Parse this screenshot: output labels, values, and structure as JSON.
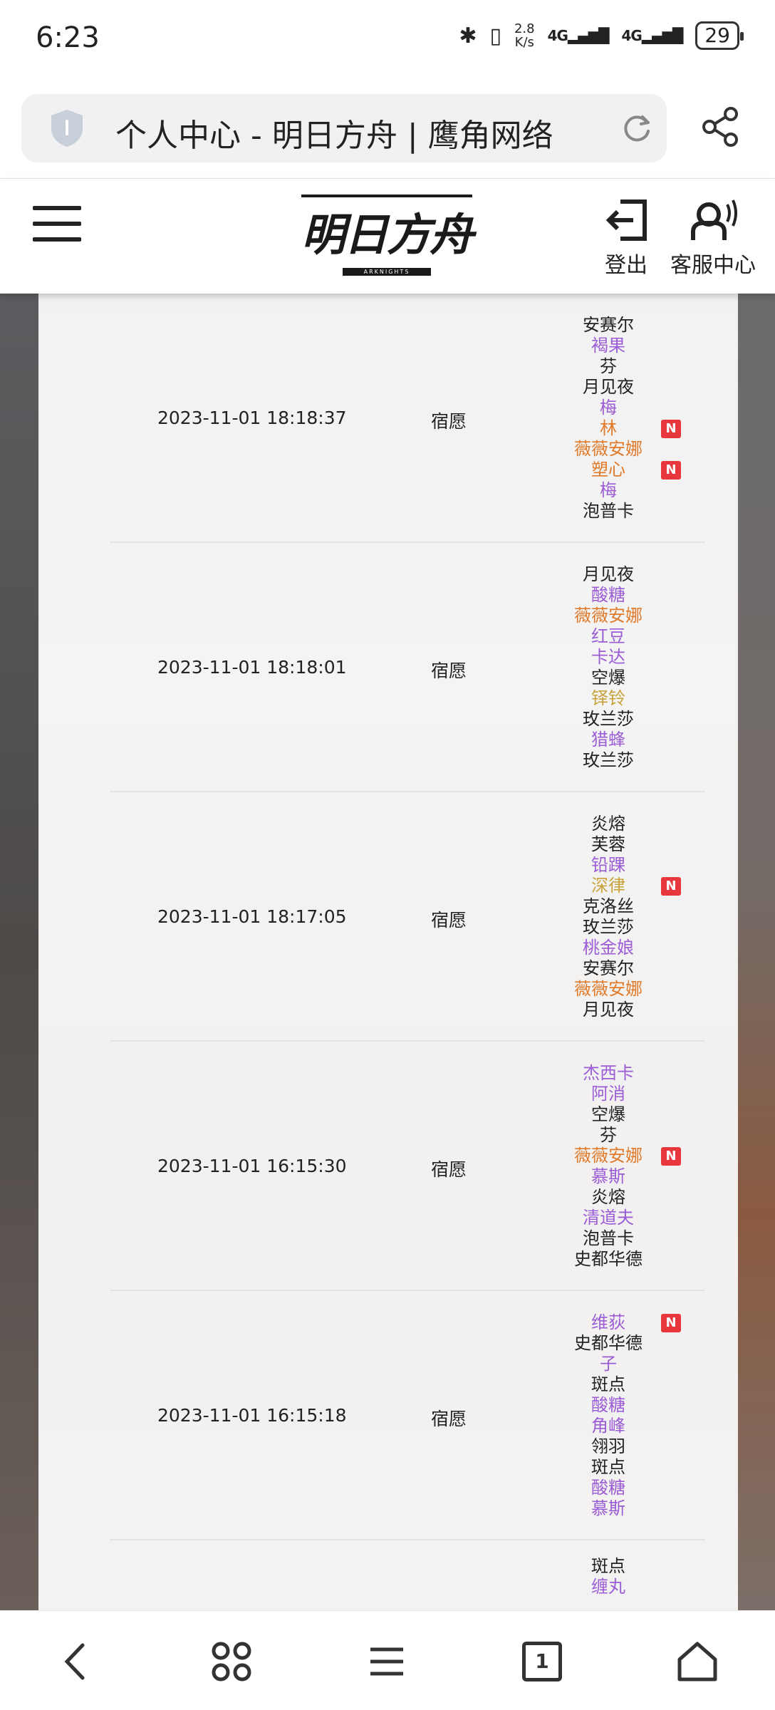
{
  "status_bar": {
    "time": "6:23",
    "net_speed_value": "2.8",
    "net_speed_unit": "K/s",
    "signal_1": "4G",
    "signal_2": "4G",
    "battery": "29"
  },
  "address_bar": {
    "title": "个人中心 - 明日方舟 | 鹰角网络"
  },
  "header": {
    "logo": "明日方舟",
    "logo_subtitle": "ARKNIGHTS",
    "logout_label": "登出",
    "service_label": "客服中心"
  },
  "rarity_colors": {
    "3": "#222222",
    "4": "#9b5cd6",
    "5": "#c8a23a",
    "6": "#e07a2a"
  },
  "records": [
    {
      "date": "2023-11-01 18:18:37",
      "pool": "宿愿",
      "operators": [
        {
          "name": "安赛尔",
          "rarity": 3,
          "new": false
        },
        {
          "name": "褐果",
          "rarity": 4,
          "new": false
        },
        {
          "name": "芬",
          "rarity": 3,
          "new": false
        },
        {
          "name": "月见夜",
          "rarity": 3,
          "new": false
        },
        {
          "name": "梅",
          "rarity": 4,
          "new": false
        },
        {
          "name": "林",
          "rarity": 6,
          "new": true
        },
        {
          "name": "薇薇安娜",
          "rarity": 6,
          "new": false
        },
        {
          "name": "塑心",
          "rarity": 6,
          "new": true
        },
        {
          "name": "梅",
          "rarity": 4,
          "new": false
        },
        {
          "name": "泡普卡",
          "rarity": 3,
          "new": false
        }
      ]
    },
    {
      "date": "2023-11-01 18:18:01",
      "pool": "宿愿",
      "operators": [
        {
          "name": "月见夜",
          "rarity": 3,
          "new": false
        },
        {
          "name": "酸糖",
          "rarity": 4,
          "new": false
        },
        {
          "name": "薇薇安娜",
          "rarity": 6,
          "new": false
        },
        {
          "name": "红豆",
          "rarity": 4,
          "new": false
        },
        {
          "name": "卡达",
          "rarity": 4,
          "new": false
        },
        {
          "name": "空爆",
          "rarity": 3,
          "new": false
        },
        {
          "name": "铎铃",
          "rarity": 5,
          "new": false
        },
        {
          "name": "玫兰莎",
          "rarity": 3,
          "new": false
        },
        {
          "name": "猎蜂",
          "rarity": 4,
          "new": false
        },
        {
          "name": "玫兰莎",
          "rarity": 3,
          "new": false
        }
      ]
    },
    {
      "date": "2023-11-01 18:17:05",
      "pool": "宿愿",
      "operators": [
        {
          "name": "炎熔",
          "rarity": 3,
          "new": false
        },
        {
          "name": "芙蓉",
          "rarity": 3,
          "new": false
        },
        {
          "name": "铅踝",
          "rarity": 4,
          "new": false
        },
        {
          "name": "深律",
          "rarity": 5,
          "new": true
        },
        {
          "name": "克洛丝",
          "rarity": 3,
          "new": false
        },
        {
          "name": "玫兰莎",
          "rarity": 3,
          "new": false
        },
        {
          "name": "桃金娘",
          "rarity": 4,
          "new": false
        },
        {
          "name": "安赛尔",
          "rarity": 3,
          "new": false
        },
        {
          "name": "薇薇安娜",
          "rarity": 6,
          "new": false
        },
        {
          "name": "月见夜",
          "rarity": 3,
          "new": false
        }
      ]
    },
    {
      "date": "2023-11-01 16:15:30",
      "pool": "宿愿",
      "operators": [
        {
          "name": "杰西卡",
          "rarity": 4,
          "new": false
        },
        {
          "name": "阿消",
          "rarity": 4,
          "new": false
        },
        {
          "name": "空爆",
          "rarity": 3,
          "new": false
        },
        {
          "name": "芬",
          "rarity": 3,
          "new": false
        },
        {
          "name": "薇薇安娜",
          "rarity": 6,
          "new": true
        },
        {
          "name": "慕斯",
          "rarity": 4,
          "new": false
        },
        {
          "name": "炎熔",
          "rarity": 3,
          "new": false
        },
        {
          "name": "清道夫",
          "rarity": 4,
          "new": false
        },
        {
          "name": "泡普卡",
          "rarity": 3,
          "new": false
        },
        {
          "name": "史都华德",
          "rarity": 3,
          "new": false
        }
      ]
    },
    {
      "date": "2023-11-01 16:15:18",
      "pool": "宿愿",
      "operators": [
        {
          "name": "维荻",
          "rarity": 4,
          "new": true
        },
        {
          "name": "史都华德",
          "rarity": 3,
          "new": false
        },
        {
          "name": "子",
          "rarity": 4,
          "new": false
        },
        {
          "name": "斑点",
          "rarity": 3,
          "new": false
        },
        {
          "name": "酸糖",
          "rarity": 4,
          "new": false
        },
        {
          "name": "角峰",
          "rarity": 4,
          "new": false
        },
        {
          "name": "翎羽",
          "rarity": 3,
          "new": false
        },
        {
          "name": "斑点",
          "rarity": 3,
          "new": false
        },
        {
          "name": "酸糖",
          "rarity": 4,
          "new": false
        },
        {
          "name": "慕斯",
          "rarity": 4,
          "new": false
        }
      ]
    },
    {
      "date": "",
      "pool": "",
      "operators": [
        {
          "name": "斑点",
          "rarity": 3,
          "new": false
        },
        {
          "name": "缠丸",
          "rarity": 4,
          "new": false
        }
      ]
    }
  ],
  "new_badge": "N",
  "bottom_nav": {
    "tab_count": "1"
  }
}
